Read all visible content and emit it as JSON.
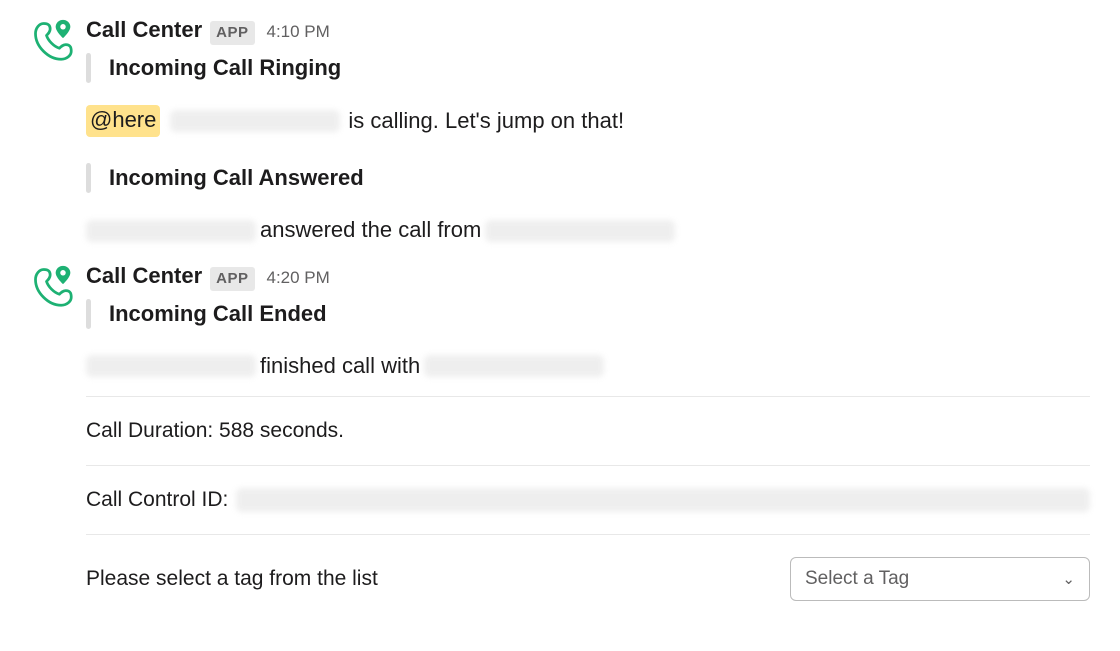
{
  "messages": [
    {
      "sender": "Call Center",
      "badge": "APP",
      "time": "4:10 PM",
      "title1": "Incoming Call Ringing",
      "line1_mention": "@here",
      "line1_text": " is calling. Let's jump on that!",
      "title2": "Incoming Call Answered",
      "line2_mid": " answered the call from "
    },
    {
      "sender": "Call Center",
      "badge": "APP",
      "time": "4:20 PM",
      "title1": "Incoming Call Ended",
      "line1_mid": " finished call with ",
      "duration_label": "Call Duration: 588 seconds.",
      "ccid_label": "Call Control ID: ",
      "tag_prompt": "Please select a tag from the list",
      "tag_placeholder": "Select a Tag"
    }
  ]
}
